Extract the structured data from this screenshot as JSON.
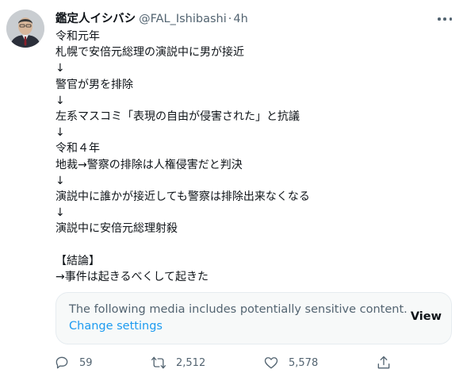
{
  "tweet": {
    "display_name": "鑑定人イシバシ",
    "handle": "@FAL_Ishibashi",
    "separator": "·",
    "time": "4h",
    "lines": [
      "令和元年",
      "札幌で安倍元総理の演説中に男が接近",
      "↓",
      "警官が男を排除",
      "↓",
      "左系マスコミ「表現の自由が侵害された」と抗議",
      "↓",
      "令和４年",
      "地裁→警察の排除は人権侵害だと判決",
      "↓",
      "演説中に誰かが接近しても警察は排除出来なくなる",
      "↓",
      "演説中に安倍元総理射殺",
      "",
      "【結論】",
      "→事件は起きるべくして起きた"
    ]
  },
  "sensitive_media": {
    "notice": "The following media includes potentially sensitive content.",
    "settings_link": "Change settings",
    "view_label": "View"
  },
  "actions": {
    "reply_count": "59",
    "retweet_count": "2,512",
    "like_count": "5,578"
  },
  "colors": {
    "accent": "#1d9bf0",
    "text_primary": "#0f1419",
    "text_secondary": "#536471",
    "card_background": "#f7f9f9"
  }
}
